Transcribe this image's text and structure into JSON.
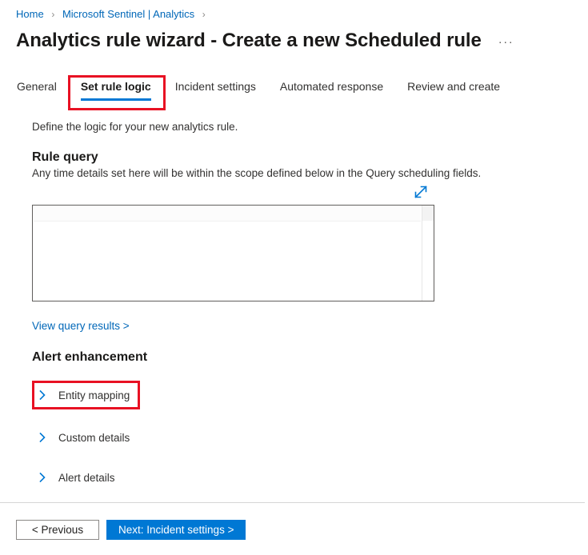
{
  "breadcrumb": {
    "items": [
      {
        "label": "Home",
        "separator": "›"
      },
      {
        "label": "Microsoft Sentinel | Analytics",
        "separator": "›"
      }
    ]
  },
  "header": {
    "title": "Analytics rule wizard - Create a new Scheduled rule",
    "more_menu": "···"
  },
  "tabs": [
    {
      "label": "General",
      "selected": false
    },
    {
      "label": "Set rule logic",
      "selected": true
    },
    {
      "label": "Incident settings",
      "selected": false
    },
    {
      "label": "Automated response",
      "selected": false
    },
    {
      "label": "Review and create",
      "selected": false
    }
  ],
  "main": {
    "intro": "Define the logic for your new analytics rule.",
    "rule_query": {
      "heading": "Rule query",
      "description": "Any time details set here will be within the scope defined below in the Query scheduling fields.",
      "expand_icon": "expand-diagonal-icon",
      "editor_value": "",
      "view_results_link": "View query results >"
    },
    "alert_enhancement": {
      "heading": "Alert enhancement",
      "sections": [
        {
          "label": "Entity mapping",
          "expanded": false,
          "icon": "chevron-right-icon"
        },
        {
          "label": "Custom details",
          "expanded": false,
          "icon": "chevron-right-icon"
        },
        {
          "label": "Alert details",
          "expanded": false,
          "icon": "chevron-right-icon"
        }
      ]
    }
  },
  "footer": {
    "previous_label": "< Previous",
    "next_label": "Next: Incident settings >"
  },
  "highlights": [
    {
      "name": "set-rule-logic-tab",
      "color": "#e81123"
    },
    {
      "name": "entity-mapping-row",
      "color": "#e81123"
    }
  ],
  "colors": {
    "accent": "#0078d4",
    "link": "#0067b8",
    "highlight": "#e81123",
    "text": "#1b1a19"
  }
}
